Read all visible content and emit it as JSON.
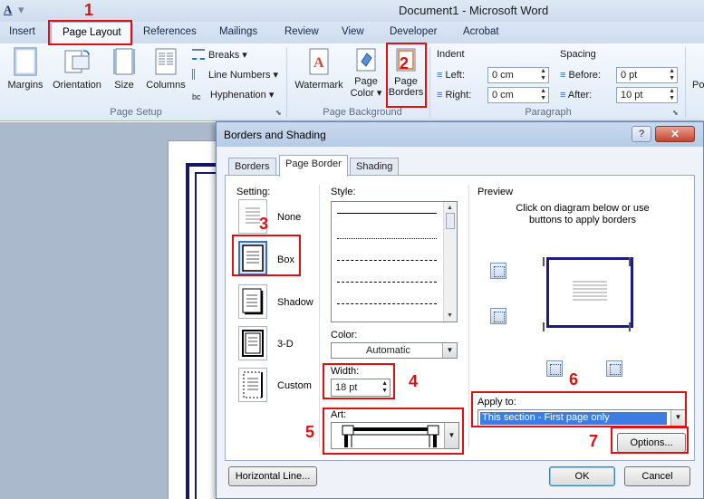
{
  "titlebar": {
    "qat_font": "A",
    "qat_more": "▾",
    "title": "Document1  -  Microsoft Word"
  },
  "ribbon": {
    "tabs": [
      "Insert",
      "Page Layout",
      "References",
      "Mailings",
      "Review",
      "View",
      "Developer",
      "Acrobat"
    ],
    "page_setup": {
      "margins": "Margins",
      "orientation": "Orientation",
      "size": "Size",
      "columns": "Columns",
      "breaks": "Breaks ▾",
      "line_numbers": "Line Numbers ▾",
      "hyphenation": "Hyphenation ▾",
      "label": "Page Setup"
    },
    "page_background": {
      "watermark": "Watermark",
      "page_color_1": "Page",
      "page_color_2": "Color ▾",
      "page_borders_1": "Page",
      "page_borders_2": "Borders",
      "label": "Page Background"
    },
    "paragraph": {
      "indent": "Indent",
      "left_label": "Left:",
      "left_value": "0 cm",
      "right_label": "Right:",
      "right_value": "0 cm",
      "spacing": "Spacing",
      "before_label": "Before:",
      "before_value": "0 pt",
      "after_label": "After:",
      "after_value": "10 pt",
      "label": "Paragraph"
    },
    "overflow": "Po"
  },
  "dialog": {
    "title": "Borders and Shading",
    "help": "?",
    "close": "✕",
    "tabs": [
      "Borders",
      "Page Border",
      "Shading"
    ],
    "setting": {
      "label": "Setting:",
      "options": [
        "None",
        "Box",
        "Shadow",
        "3-D",
        "Custom"
      ]
    },
    "style_label": "Style:",
    "color_label": "Color:",
    "color_value": "Automatic",
    "width_label": "Width:",
    "width_value": "18 pt",
    "art_label": "Art:",
    "preview": {
      "label": "Preview",
      "hint": "Click on diagram below or use buttons to apply borders"
    },
    "apply_to_label": "Apply to:",
    "apply_to_value": "This section - First page only",
    "options_button": "Options...",
    "horizontal_line_button": "Horizontal Line...",
    "ok": "OK",
    "cancel": "Cancel"
  },
  "annotations": [
    "1",
    "2",
    "3",
    "4",
    "5",
    "6",
    "7"
  ],
  "colors": {
    "annotation_red": "#e01010",
    "border_navy": "#1c1c82",
    "selection_blue": "#3b7de0"
  }
}
